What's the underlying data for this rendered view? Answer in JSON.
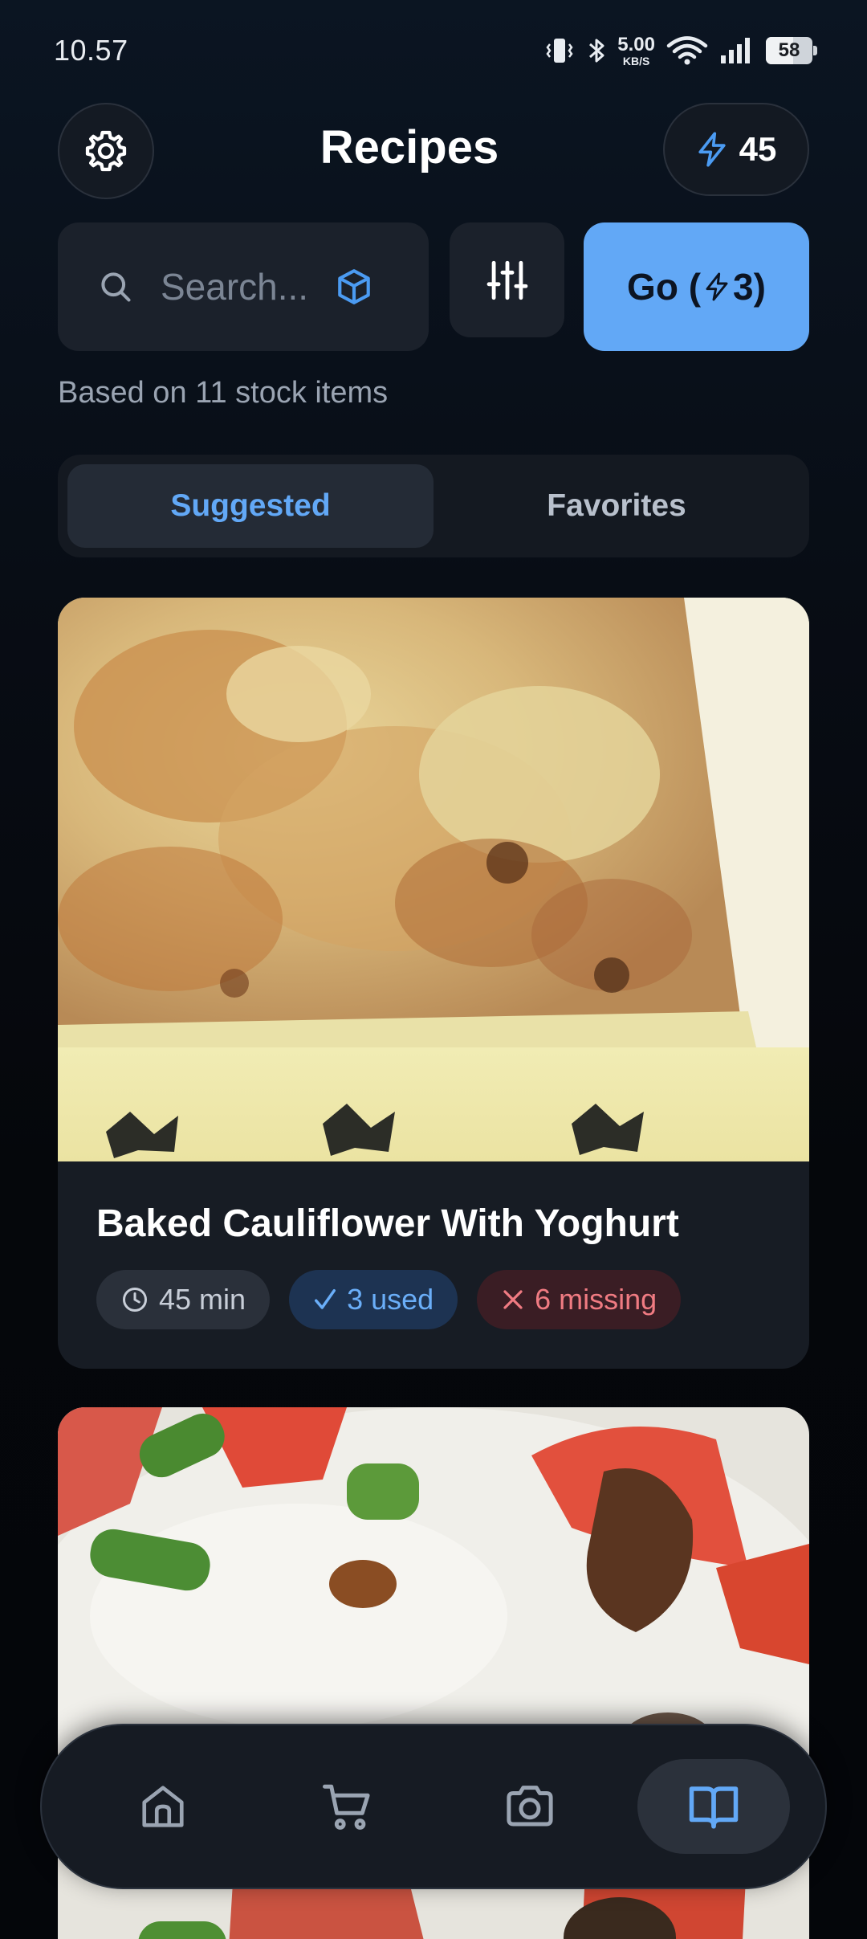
{
  "status_bar": {
    "time": "10.57",
    "net_speed_value": "5.00",
    "net_speed_unit": "KB/S",
    "battery_level": "58"
  },
  "header": {
    "title": "Recipes",
    "credits": "45",
    "settings_icon": "gear-icon",
    "credits_icon": "lightning-icon"
  },
  "search": {
    "placeholder": "Search...",
    "filter_icon": "sliders-icon",
    "cube_icon": "cube-icon"
  },
  "go_button": {
    "prefix": "Go (",
    "cost": "3)"
  },
  "stock_note": "Based on 11 stock items",
  "tabs": [
    {
      "label": "Suggested",
      "active": true
    },
    {
      "label": "Favorites",
      "active": false
    }
  ],
  "recipes": [
    {
      "title": "Baked Cauliflower With Yoghurt",
      "time": "45 min",
      "used": "3 used",
      "missing": "6 missing"
    },
    {
      "title": ""
    }
  ],
  "bottom_nav": [
    {
      "icon": "home-icon",
      "active": false
    },
    {
      "icon": "cart-icon",
      "active": false
    },
    {
      "icon": "camera-icon",
      "active": false
    },
    {
      "icon": "book-icon",
      "active": true
    }
  ],
  "colors": {
    "accent": "#62a8f6",
    "used_chip": "#1d3352",
    "missing_chip": "#3a1d24",
    "missing_text": "#f07b82"
  }
}
